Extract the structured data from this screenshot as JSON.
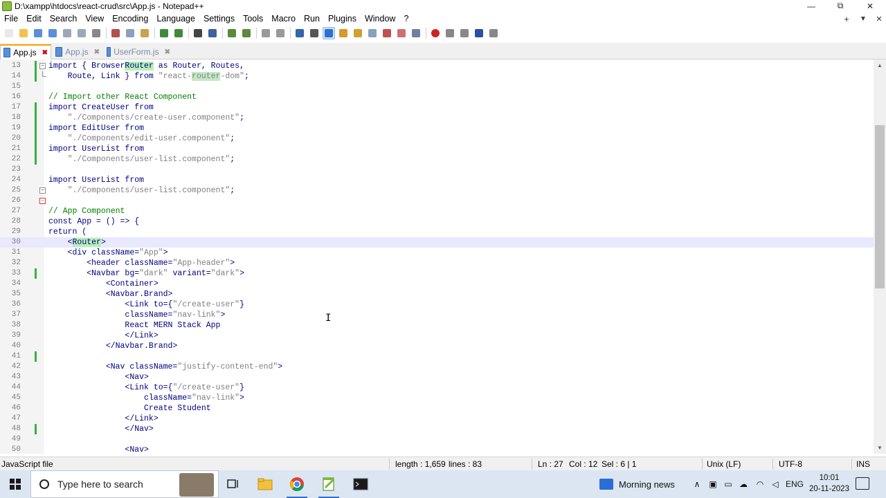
{
  "window": {
    "title": "D:\\xampp\\htdocs\\react-crud\\src\\App.js - Notepad++",
    "controls": {
      "minimize": "—",
      "restore": "⧉",
      "close": "✕"
    }
  },
  "menu": {
    "items": [
      "File",
      "Edit",
      "Search",
      "View",
      "Encoding",
      "Language",
      "Settings",
      "Tools",
      "Macro",
      "Run",
      "Plugins",
      "Window",
      "?"
    ],
    "right": {
      "new_tab": "+",
      "dropdown": "▼",
      "close": "✕"
    }
  },
  "toolbar": {
    "icons": [
      "new-file-icon",
      "open-file-icon",
      "save-icon",
      "save-all-icon",
      "close-icon",
      "close-all-icon",
      "print-icon",
      "cut-icon",
      "copy-icon",
      "paste-icon",
      "undo-icon",
      "redo-icon",
      "find-icon",
      "replace-icon",
      "zoom-in-icon",
      "zoom-out-icon",
      "sync-vertical-icon",
      "sync-horizontal-icon",
      "word-wrap-icon",
      "show-all-chars-icon",
      "indent-guide-icon",
      "user-language-icon",
      "doc-map-icon",
      "doc-list-icon",
      "function-list-icon",
      "folder-workspace-icon",
      "monitoring-icon",
      "record-macro-icon",
      "stop-macro-icon",
      "play-macro-icon",
      "run-macro-multiple-icon",
      "save-macro-icon"
    ]
  },
  "tabs": [
    {
      "label": "App.js",
      "active": true
    },
    {
      "label": "App.js",
      "active": false
    },
    {
      "label": "UserForm.js",
      "active": false
    }
  ],
  "editor": {
    "lines": [
      {
        "n": "13",
        "text": "import { BrowserRouter as Router, Routes,",
        "fold": "minus",
        "chg": true
      },
      {
        "n": "14",
        "text": "    Route, Link } from \"react-router-dom\";",
        "fold": "end",
        "chg": true
      },
      {
        "n": "15",
        "text": ""
      },
      {
        "n": "16",
        "text": "// Import other React Component"
      },
      {
        "n": "17",
        "text": "import CreateUser from",
        "chg": true
      },
      {
        "n": "18",
        "text": "    \"./Components/create-user.component\";",
        "chg": true
      },
      {
        "n": "19",
        "text": "import EditUser from",
        "chg": true
      },
      {
        "n": "20",
        "text": "    \"./Components/edit-user.component\";",
        "chg": true
      },
      {
        "n": "21",
        "text": "import UserList from",
        "chg": true
      },
      {
        "n": "22",
        "text": "    \"./Components/user-list.component\";",
        "chg": true
      },
      {
        "n": "23",
        "text": ""
      },
      {
        "n": "24",
        "text": "import UserList from"
      },
      {
        "n": "25",
        "text": "    \"./Components/user-list.component\";",
        "fold": "minus"
      },
      {
        "n": "26",
        "text": "",
        "fold": "red"
      },
      {
        "n": "27",
        "text": "// App Component"
      },
      {
        "n": "28",
        "text": "const App = () => {"
      },
      {
        "n": "29",
        "text": "return ("
      },
      {
        "n": "30",
        "text": "    <Router>",
        "current": true
      },
      {
        "n": "31",
        "text": "    <div className=\"App\">"
      },
      {
        "n": "32",
        "text": "        <header className=\"App-header\">"
      },
      {
        "n": "33",
        "text": "        <Navbar bg=\"dark\" variant=\"dark\">",
        "chg": true
      },
      {
        "n": "34",
        "text": "            <Container>"
      },
      {
        "n": "35",
        "text": "            <Navbar.Brand>"
      },
      {
        "n": "36",
        "text": "                <Link to={\"/create-user\"}"
      },
      {
        "n": "37",
        "text": "                className=\"nav-link\">"
      },
      {
        "n": "38",
        "text": "                React MERN Stack App"
      },
      {
        "n": "39",
        "text": "                </Link>"
      },
      {
        "n": "40",
        "text": "            </Navbar.Brand>"
      },
      {
        "n": "41",
        "text": "",
        "chg": true
      },
      {
        "n": "42",
        "text": "            <Nav className=\"justify-content-end\">"
      },
      {
        "n": "43",
        "text": "                <Nav>"
      },
      {
        "n": "44",
        "text": "                <Link to={\"/create-user\"}"
      },
      {
        "n": "45",
        "text": "                    className=\"nav-link\">"
      },
      {
        "n": "46",
        "text": "                    Create Student"
      },
      {
        "n": "47",
        "text": "                </Link>"
      },
      {
        "n": "48",
        "text": "                </Nav>",
        "chg": true
      },
      {
        "n": "49",
        "text": ""
      },
      {
        "n": "50",
        "text": "                <Nav>"
      }
    ]
  },
  "status": {
    "file_type": "JavaScript file",
    "length": "length : 1,659",
    "lines": "lines : 83",
    "ln": "Ln : 27",
    "col": "Col : 12",
    "sel": "Sel : 6 | 1",
    "eol": "Unix (LF)",
    "encoding": "UTF-8",
    "mode": "INS"
  },
  "taskbar": {
    "search_placeholder": "Type here to search",
    "news": "Morning news",
    "language": "ENG",
    "time": "10:01",
    "date": "20-11-2023"
  },
  "colors": {
    "keyword": "#000080",
    "string": "#808080",
    "comment": "#008000",
    "highlight": "#b7f0b7",
    "current_line": "#e8e8ff",
    "change_marker": "#38b040"
  }
}
